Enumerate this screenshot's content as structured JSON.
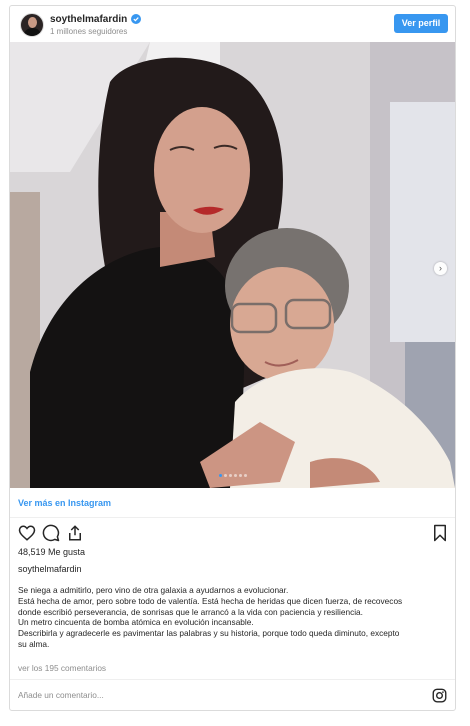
{
  "header": {
    "username": "soythelmafardin",
    "followers": "1 millones seguidores",
    "view_profile": "Ver perfil"
  },
  "post": {
    "view_more": "Ver más en Instagram",
    "likes": "48,519 Me gusta",
    "author": "soythelmafardin",
    "caption_lines": [
      "Se niega a admitirlo, pero vino de otra galaxia a ayudarnos a evolucionar.",
      "Está hecha de amor, pero sobre todo de valentía. Está hecha de heridas que dicen fuerza, de recovecos",
      "donde escribió perseverancia, de sonrisas que le arrancó a la vida con paciencia y resiliencia.",
      "Un metro cincuenta de bomba atómica en evolución incansable.",
      "Describirla y agradecerle es pavimentar las palabras y su historia, porque todo queda diminuto, excepto",
      "su alma."
    ],
    "comments_link": "ver los 195 comentarios",
    "comment_placeholder": "Añade un comentario..."
  },
  "carousel": {
    "slides": 6,
    "active": 1
  },
  "colors": {
    "accent": "#3897f0",
    "text": "#262626",
    "muted": "#8e8e8e"
  },
  "icons": [
    "verified-badge-icon",
    "heart-icon",
    "comment-icon",
    "share-icon",
    "bookmark-icon",
    "instagram-logo-icon",
    "next-arrow-icon"
  ]
}
